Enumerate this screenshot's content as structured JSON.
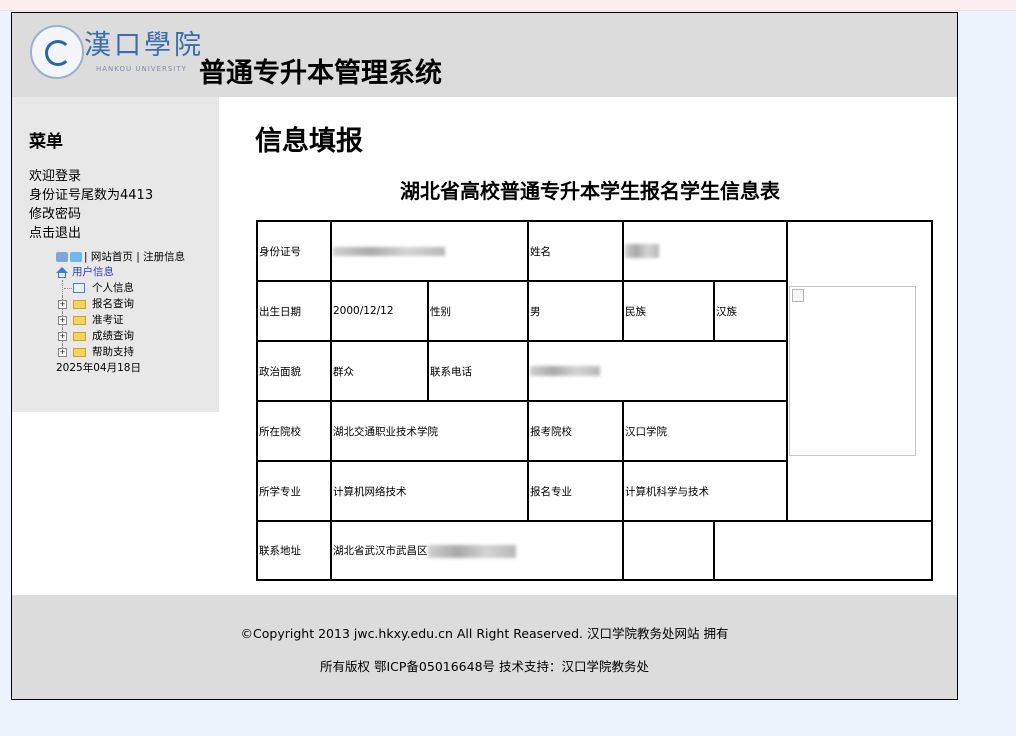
{
  "header": {
    "logo_text": "漢口學院",
    "logo_sub": "HANKOU UNIVERSITY",
    "system_title": "普通专升本管理系统"
  },
  "sidebar": {
    "menu_title": "菜单",
    "welcome": "欢迎登录",
    "id_tail": "身份证号尾数为4413",
    "change_password": "修改密码",
    "logout": "点击退出",
    "site_home": "网站首页",
    "separator": "|",
    "logout_info": "注册信息",
    "tree": {
      "root": "用户信息",
      "items": [
        "个人信息",
        "报名查询",
        "准考证",
        "成绩查询",
        "帮助支持"
      ],
      "date": "2025年04月18日"
    }
  },
  "main": {
    "page_title": "信息填报",
    "form_title": "湖北省高校普通专升本学生报名学生信息表",
    "labels": {
      "id_number": "身份证号",
      "name": "姓名",
      "birth_date": "出生日期",
      "gender": "性别",
      "ethnicity": "民族",
      "political_status": "政治面貌",
      "phone": "联系电话",
      "current_school": "所在院校",
      "apply_school": "报考院校",
      "current_major": "所学专业",
      "apply_major": "报名专业",
      "address": "联系地址"
    },
    "values": {
      "birth_date": "2000/12/12",
      "gender": "男",
      "ethnicity": "汉族",
      "political_status": "群众",
      "current_school": "湖北交通职业技术学院",
      "apply_school": "汉口学院",
      "current_major": "计算机网络技术",
      "apply_major": "计算机科学与技术",
      "address_prefix": "湖北省武汉市武昌区"
    }
  },
  "footer": {
    "line1": "©Copyright 2013 jwc.hkxy.edu.cn All Right Reaserved. 汉口学院教务处网站 拥有",
    "line2": "所有版权 鄂ICP备05016648号 技术支持：汉口学院教务处"
  }
}
